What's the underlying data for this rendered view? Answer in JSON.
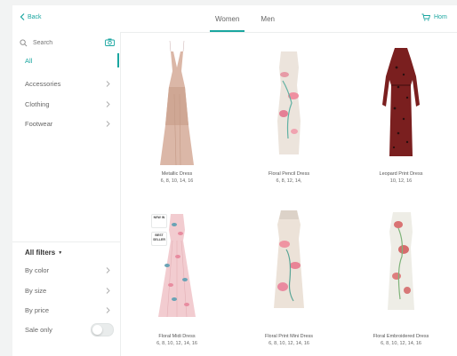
{
  "header": {
    "back_label": "Back",
    "tabs": [
      {
        "label": "Women",
        "active": true
      },
      {
        "label": "Men",
        "active": false
      }
    ],
    "cart_label": "Hom"
  },
  "sidebar": {
    "search_placeholder": "Search",
    "categories": [
      {
        "label": "All",
        "active": true
      },
      {
        "label": "Accessories",
        "active": false
      },
      {
        "label": "Clothing",
        "active": false
      },
      {
        "label": "Footwear",
        "active": false
      }
    ],
    "filters_title": "All filters",
    "filters": [
      {
        "label": "By color"
      },
      {
        "label": "By size"
      },
      {
        "label": "By price"
      }
    ],
    "sale_only_label": "Sale only",
    "sale_only_on": false
  },
  "products": [
    {
      "name": "Metallic Dress",
      "sizes": "6, 8, 10, 14, 16",
      "color": "#d9b3a3",
      "style": "slip"
    },
    {
      "name": "Floral Pencil Dress",
      "sizes": "6, 8, 12, 14,",
      "color": "#ece6df",
      "style": "pencil"
    },
    {
      "name": "Leopard Print Dress",
      "sizes": "10, 12, 16",
      "color": "#7a1c1c",
      "style": "longsleeve"
    },
    {
      "name": "Floral Midi Dress",
      "sizes": "6, 8, 10, 12, 14, 16",
      "color": "#f0c8cc",
      "style": "midi"
    },
    {
      "name": "Floral Print Mini Dress",
      "sizes": "6, 8, 10, 12, 14, 16",
      "color": "#ece0d6",
      "style": "mini"
    },
    {
      "name": "Floral Embroidered Dress",
      "sizes": "6, 8, 10, 12, 14, 16",
      "color": "#efeee8",
      "style": "embroidered"
    }
  ],
  "badges": [
    "NEW IN",
    "BEST SELLER"
  ],
  "colors": {
    "accent": "#1aa6a0"
  }
}
